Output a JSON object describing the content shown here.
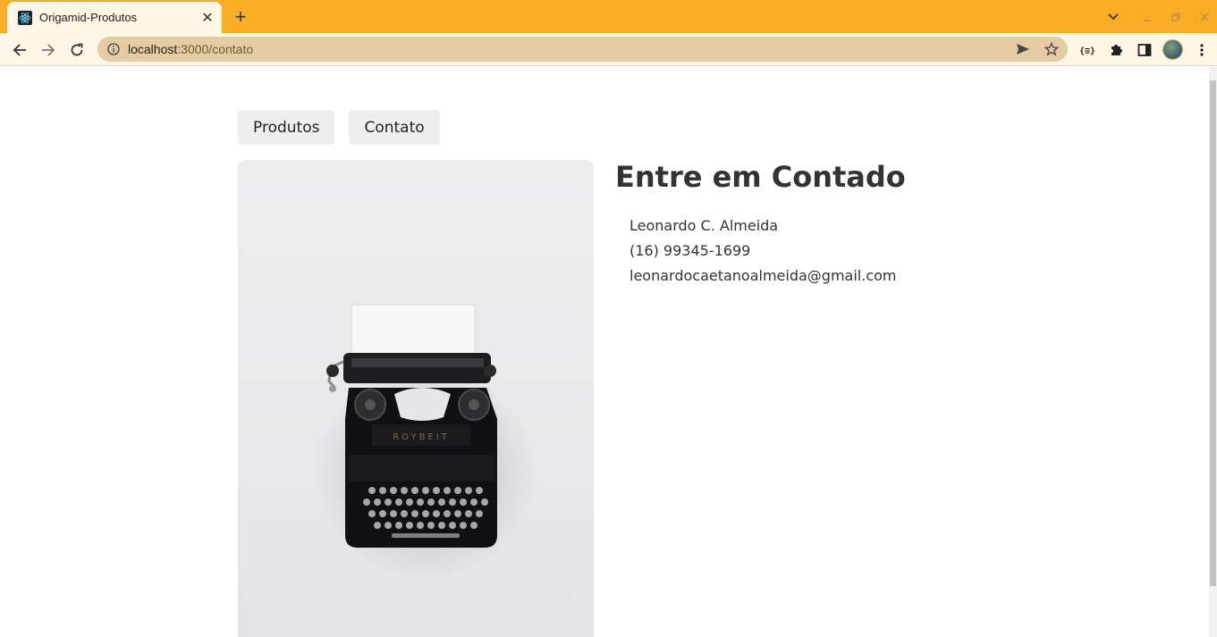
{
  "browser": {
    "tab_title": "Origamid-Produtos",
    "tab_close": "✕",
    "new_tab": "+",
    "url_host": "localhost",
    "url_path": ":3000/contato"
  },
  "nav": {
    "links": [
      "Produtos",
      "Contato"
    ]
  },
  "contact": {
    "title": "Entre em Contado",
    "items": [
      "Leonardo C. Almeida",
      "(16) 99345-1699",
      "leonardocaetanoalmeida@gmail.com"
    ]
  },
  "colors": {
    "tabbar": "#f9ad27",
    "toolbar": "#fff6e6",
    "omnibox": "#e4cba1",
    "nav_bg": "#eeeeee",
    "text": "#333333"
  },
  "icons": {
    "favicon": "react-atom-icon",
    "photo": "typewriter-photo"
  }
}
